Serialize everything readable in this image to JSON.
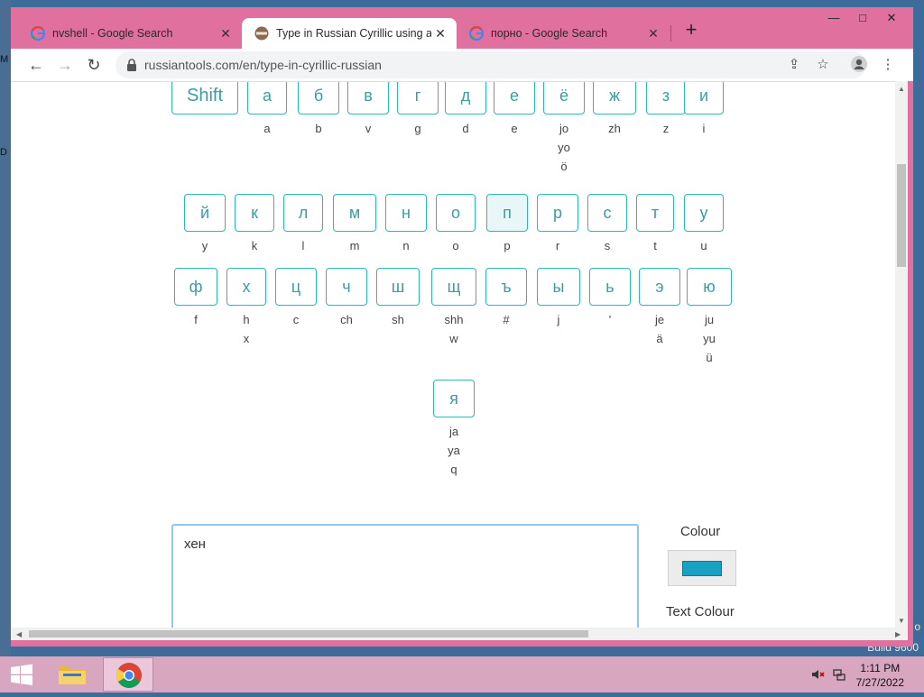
{
  "desktop": {
    "side_text_1": "M",
    "side_text_2": "D",
    "build_line_1": "o",
    "build_line_2": "Build 9600"
  },
  "tabs": [
    {
      "title": "nvshell - Google Search",
      "favicon": "google-icon",
      "active": false
    },
    {
      "title": "Type in Russian Cyrillic using an English",
      "favicon": "russiantools-icon",
      "active": true
    },
    {
      "title": "порно - Google Search",
      "favicon": "google-icon",
      "active": false
    }
  ],
  "window_controls": {
    "minimize": "—",
    "maximize": "□",
    "close": "✕"
  },
  "toolbar": {
    "back": "←",
    "forward": "→",
    "reload": "↻",
    "url": "russiantools.com/en/type-in-cyrillic-russian",
    "share_icon": "share-icon",
    "star_icon": "star-icon",
    "profile_icon": "profile-icon",
    "menu_icon": "kebab-menu-icon"
  },
  "keyboard": {
    "row1": [
      {
        "key": "Shift",
        "lat": []
      },
      {
        "key": "а",
        "lat": [
          "a"
        ]
      },
      {
        "key": "б",
        "lat": [
          "b"
        ]
      },
      {
        "key": "в",
        "lat": [
          "v"
        ]
      },
      {
        "key": "г",
        "lat": [
          "g"
        ]
      },
      {
        "key": "д",
        "lat": [
          "d"
        ]
      },
      {
        "key": "е",
        "lat": [
          "e"
        ]
      },
      {
        "key": "ё",
        "lat": [
          "jo",
          "yo",
          "ö"
        ]
      },
      {
        "key": "ж",
        "lat": [
          "zh"
        ]
      },
      {
        "key": "з",
        "lat": [
          "z"
        ]
      },
      {
        "key": "и",
        "lat": [
          "i"
        ]
      }
    ],
    "row2": [
      {
        "key": "й",
        "lat": [
          "y"
        ]
      },
      {
        "key": "к",
        "lat": [
          "k"
        ]
      },
      {
        "key": "л",
        "lat": [
          "l"
        ]
      },
      {
        "key": "м",
        "lat": [
          "m"
        ]
      },
      {
        "key": "н",
        "lat": [
          "n"
        ]
      },
      {
        "key": "о",
        "lat": [
          "o"
        ]
      },
      {
        "key": "п",
        "lat": [
          "p"
        ],
        "highlight": true
      },
      {
        "key": "р",
        "lat": [
          "r"
        ]
      },
      {
        "key": "с",
        "lat": [
          "s"
        ]
      },
      {
        "key": "т",
        "lat": [
          "t"
        ]
      },
      {
        "key": "у",
        "lat": [
          "u"
        ]
      }
    ],
    "row3": [
      {
        "key": "ф",
        "lat": [
          "f"
        ]
      },
      {
        "key": "х",
        "lat": [
          "h",
          "x"
        ]
      },
      {
        "key": "ц",
        "lat": [
          "c"
        ]
      },
      {
        "key": "ч",
        "lat": [
          "ch"
        ]
      },
      {
        "key": "ш",
        "lat": [
          "sh"
        ]
      },
      {
        "key": "щ",
        "lat": [
          "shh",
          "w"
        ]
      },
      {
        "key": "ъ",
        "lat": [
          "#"
        ]
      },
      {
        "key": "ы",
        "lat": [
          "j"
        ]
      },
      {
        "key": "ь",
        "lat": [
          "'"
        ]
      },
      {
        "key": "э",
        "lat": [
          "je",
          "ä"
        ]
      },
      {
        "key": "ю",
        "lat": [
          "ju",
          "yu",
          "ü"
        ]
      }
    ],
    "row4": [
      {
        "key": "я",
        "lat": [
          "ja",
          "ya",
          "q"
        ]
      }
    ]
  },
  "editor": {
    "text": "хен"
  },
  "side": {
    "colour_label": "Colour",
    "text_colour_label": "Text Colour",
    "colour_value": "#1aa0c0"
  },
  "taskbar": {
    "time": "1:11 PM",
    "date": "7/27/2022"
  }
}
